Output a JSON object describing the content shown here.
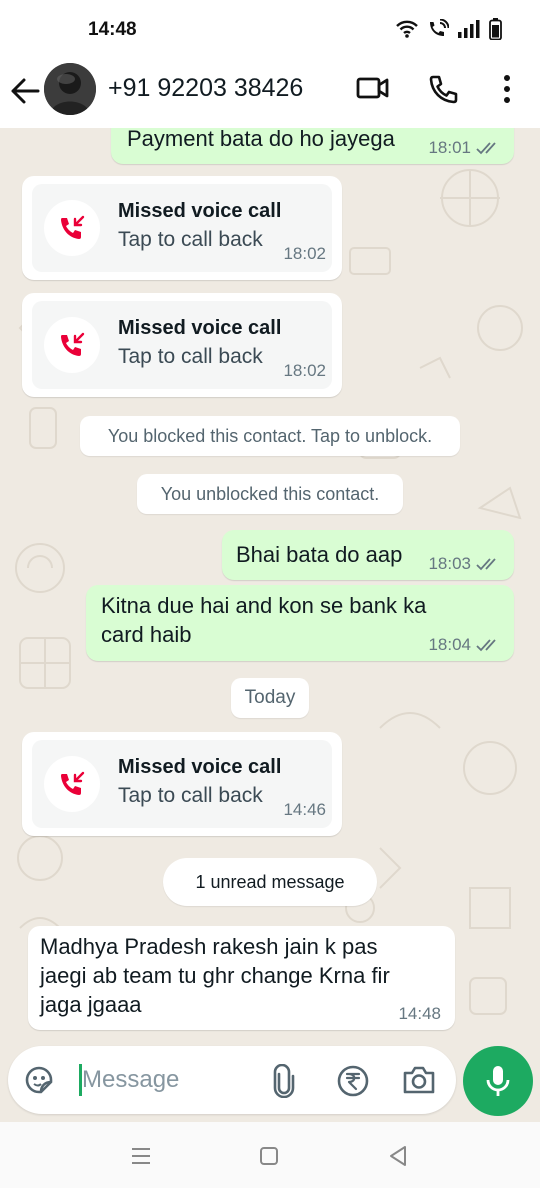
{
  "status_bar": {
    "time": "14:48"
  },
  "header": {
    "contact_name": "+91 92203 38426"
  },
  "messages": {
    "m1": {
      "text": "Payment bata do ho jayega",
      "time": "18:01"
    },
    "c1": {
      "title": "Missed voice call",
      "subtitle": "Tap to call back",
      "time": "18:02"
    },
    "c2": {
      "title": "Missed voice call",
      "subtitle": "Tap to call back",
      "time": "18:02"
    },
    "s1": {
      "text": "You blocked this contact. Tap to unblock."
    },
    "s2": {
      "text": "You unblocked this contact."
    },
    "m2": {
      "text": "Bhai bata do aap",
      "time": "18:03"
    },
    "m3": {
      "line1": "Kitna due hai and kon se bank ka",
      "line2": "card haib",
      "time": "18:04"
    },
    "date": {
      "text": "Today"
    },
    "c3": {
      "title": "Missed voice call",
      "subtitle": "Tap to call back",
      "time": "14:46"
    },
    "unread": {
      "text": "1 unread message"
    },
    "m4": {
      "line1": "Madhya Pradesh rakesh jain k pas",
      "line2": "jaegi ab team tu ghr change Krna fir",
      "line3": "jaga jgaaa",
      "time": "14:48"
    }
  },
  "composer": {
    "placeholder": "Message"
  },
  "icons": {
    "back": "back-arrow-icon",
    "video": "video-call-icon",
    "phone": "voice-call-icon",
    "menu": "more-options-icon",
    "missed": "missed-call-icon",
    "emoji": "sticker-icon",
    "attach": "attach-icon",
    "payment": "rupee-icon",
    "camera": "camera-icon",
    "mic": "microphone-icon",
    "read": "double-check-icon"
  },
  "colors": {
    "outgoing": "#d9fdd3",
    "incoming": "#ffffff",
    "accent": "#1daa61",
    "missed": "#ea0038",
    "wallpaper": "#efeae2"
  }
}
